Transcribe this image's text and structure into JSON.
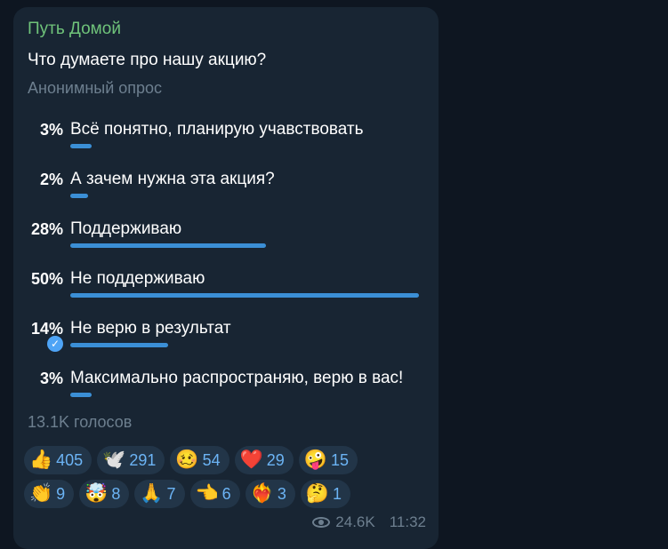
{
  "channel": {
    "name": "Путь Домой"
  },
  "poll": {
    "question": "Что думаете про нашу акцию?",
    "type": "Анонимный опрос",
    "options": [
      {
        "percent": "3%",
        "value": 3,
        "label": "Всё понятно, планирую учавствовать"
      },
      {
        "percent": "2%",
        "value": 2,
        "label": "А зачем нужна эта акция?"
      },
      {
        "percent": "28%",
        "value": 28,
        "label": "Поддерживаю"
      },
      {
        "percent": "50%",
        "value": 50,
        "label": "Не поддерживаю"
      },
      {
        "percent": "14%",
        "value": 14,
        "label": "Не верю в результат",
        "selected": true
      },
      {
        "percent": "3%",
        "value": 3,
        "label": "Максимально распространяю, верю в вас!"
      }
    ],
    "total_votes": "13.1K голосов"
  },
  "reactions": [
    {
      "emoji": "👍",
      "count": "405"
    },
    {
      "emoji": "🕊️",
      "count": "291"
    },
    {
      "emoji": "🥴",
      "count": "54"
    },
    {
      "emoji": "❤️",
      "count": "29"
    },
    {
      "emoji": "🤪",
      "count": "15"
    },
    {
      "emoji": "👏",
      "count": "9"
    },
    {
      "emoji": "🤯",
      "count": "8"
    },
    {
      "emoji": "🙏",
      "count": "7"
    },
    {
      "emoji": "👈",
      "count": "6"
    },
    {
      "emoji": "❤️‍🔥",
      "count": "3"
    },
    {
      "emoji": "🤔",
      "count": "1"
    }
  ],
  "meta": {
    "views": "24.6K",
    "time": "11:32",
    "views_icon": "eye-icon"
  },
  "colors": {
    "bar": "#3b8fd6",
    "channel": "#6fc37a",
    "check": "#4ea4f6"
  }
}
